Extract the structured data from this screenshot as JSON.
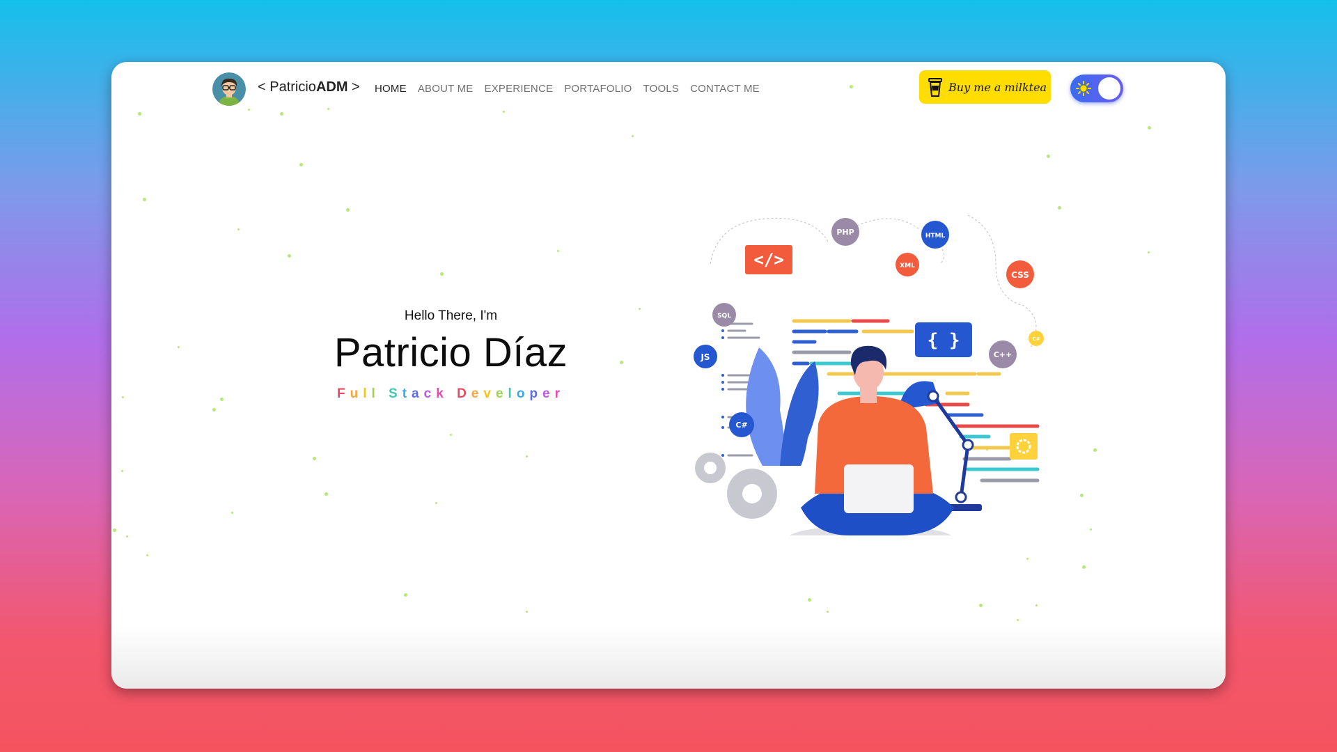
{
  "nav": {
    "brand_prefix": "< Patricio",
    "brand_bold": "ADM",
    "brand_suffix": " >",
    "items": [
      {
        "label": "HOME",
        "active": true
      },
      {
        "label": "ABOUT ME"
      },
      {
        "label": "EXPERIENCE"
      },
      {
        "label": "PORTAFOLIO"
      },
      {
        "label": "TOOLS"
      },
      {
        "label": "CONTACT ME"
      }
    ],
    "milktea_label": "Buy me a milktea",
    "theme_toggle": {
      "state": "light",
      "icon": "sun-icon"
    }
  },
  "hero": {
    "greeting": "Hello There, I'm",
    "name": "Patricio Díaz",
    "role": "Full Stack Developer",
    "role_colors": [
      "#e84a5f",
      "#f7a440",
      "#f5c518",
      "#9bd34b",
      "#3cc8b0",
      "#39a7e8",
      "#5b6ce8",
      "#b95ae0",
      "#e84ab0"
    ]
  },
  "illustration": {
    "badges": [
      "PHP",
      "HTML",
      "XML",
      "CSS",
      "SQL",
      "JS",
      "C++",
      "C#",
      "C#"
    ],
    "code_tag": "</>",
    "braces": "{ }"
  },
  "colors": {
    "accent_yellow": "#ffdd00",
    "toggle_blue": "#3a6cf0",
    "particles": "#b7e87a"
  }
}
